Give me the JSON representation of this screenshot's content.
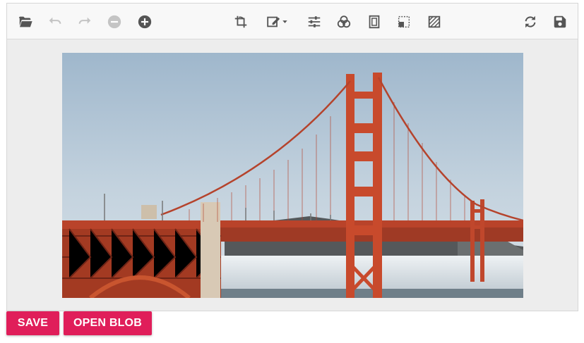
{
  "toolbar": {
    "left": [
      {
        "name": "open-folder-icon",
        "enabled": true
      },
      {
        "name": "undo-icon",
        "enabled": false
      },
      {
        "name": "redo-icon",
        "enabled": false
      },
      {
        "name": "zoom-out-icon",
        "enabled": false
      },
      {
        "name": "zoom-in-icon",
        "enabled": true
      }
    ],
    "center": [
      {
        "name": "crop-icon"
      },
      {
        "name": "annotate-icon",
        "has_dropdown": true
      },
      {
        "name": "adjust-sliders-icon"
      },
      {
        "name": "filter-icon"
      },
      {
        "name": "frame-icon"
      },
      {
        "name": "straighten-icon"
      },
      {
        "name": "pattern-icon"
      }
    ],
    "right": [
      {
        "name": "reset-icon"
      },
      {
        "name": "save-icon"
      }
    ],
    "icon_color": "#555555",
    "disabled_color": "#c4c4c4"
  },
  "image": {
    "subject": "golden-gate-bridge-photo",
    "sky_top": "#9fb7cc",
    "bridge_color": "#c84a2c"
  },
  "actions": {
    "save_label": "SAVE",
    "open_blob_label": "OPEN BLOB"
  },
  "colors": {
    "accent": "#e01e5a"
  }
}
